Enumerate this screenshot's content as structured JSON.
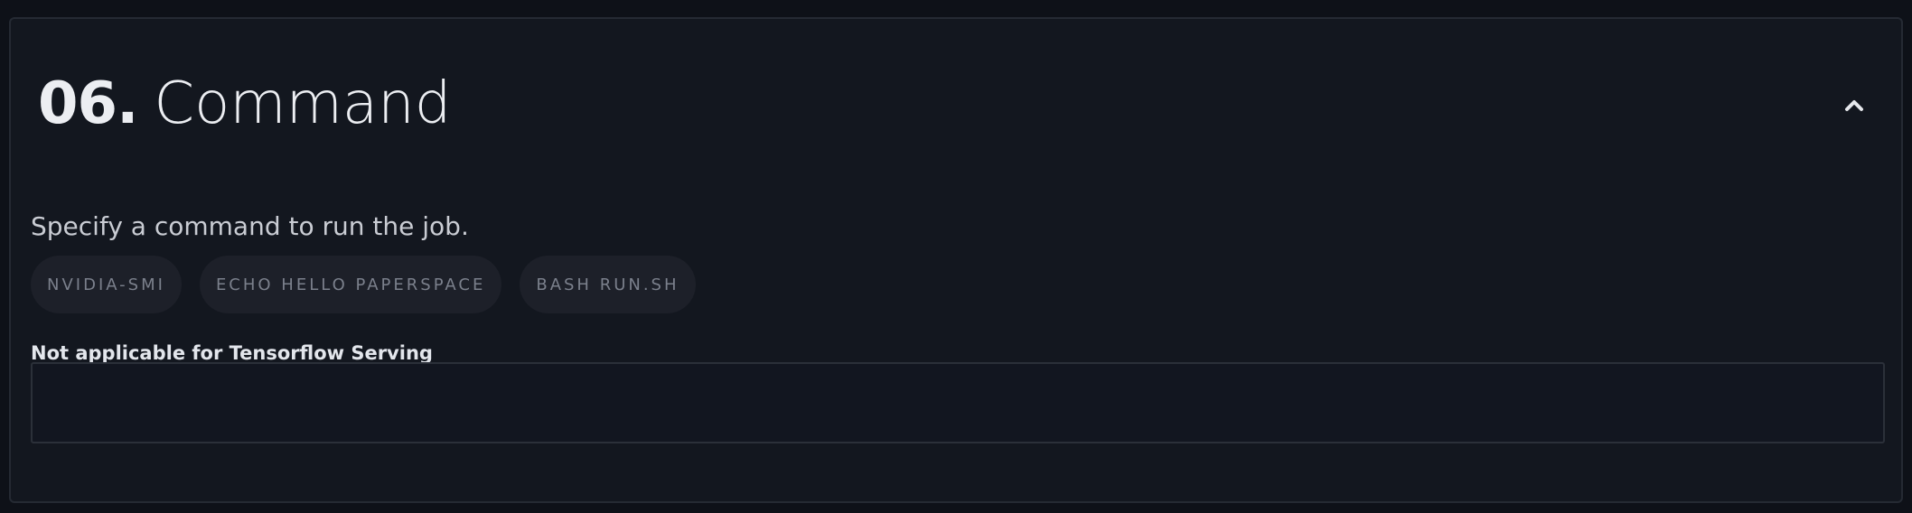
{
  "section": {
    "number": "06.",
    "title": "Command",
    "collapse_icon": "chevron-up-icon"
  },
  "description": "Specify a command to run the job.",
  "suggestions": [
    {
      "label": "NVIDIA-SMI"
    },
    {
      "label": "ECHO HELLO PAPERSPACE"
    },
    {
      "label": "BASH RUN.SH"
    }
  ],
  "command_field": {
    "label": "Not applicable for Tensorflow Serving",
    "value": "",
    "placeholder": ""
  },
  "colors": {
    "background": "#0e1118",
    "panel": "#13171f",
    "chip_bg": "#1d2029",
    "chip_text": "#7b808c",
    "title_text": "#eceef2"
  }
}
